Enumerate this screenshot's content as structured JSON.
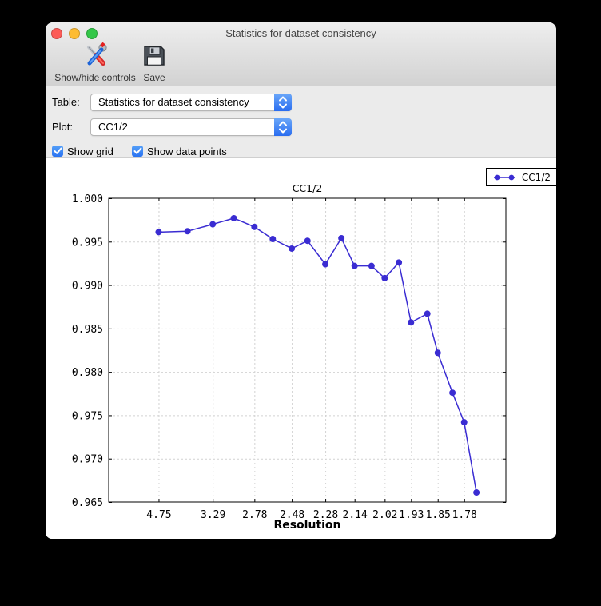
{
  "window": {
    "title": "Statistics for dataset consistency",
    "traffic_lights": {
      "close": "#fc5b57",
      "minimize": "#fdbc32",
      "maximize": "#33c748"
    }
  },
  "toolbar": {
    "items": [
      {
        "label": "Show/hide controls",
        "icon": "tools-icon"
      },
      {
        "label": "Save",
        "icon": "save-icon"
      }
    ]
  },
  "controls": {
    "table": {
      "label": "Table:",
      "value": "Statistics for dataset consistency"
    },
    "plot": {
      "label": "Plot:",
      "value": "CC1/2"
    },
    "checkboxes": [
      {
        "label": "Show grid",
        "checked": true
      },
      {
        "label": "Show data points",
        "checked": true
      }
    ],
    "accent_color": "#2f7bf3"
  },
  "legend": {
    "label": "CC1/2",
    "position": "top-right"
  },
  "chart_data": {
    "type": "line",
    "title": "CC1/2",
    "xlabel": "Resolution",
    "x_scale": "inverse_d_squared",
    "xlim_inv_d2": [
      0,
      0.3527
    ],
    "ylim": [
      0.965,
      1.0
    ],
    "grid": true,
    "grid_style": "dashed",
    "x_tick_labels": [
      "4.75",
      "3.29",
      "2.78",
      "2.48",
      "2.28",
      "2.14",
      "2.02",
      "1.93",
      "1.85",
      "1.78"
    ],
    "y_tick_labels": [
      "1.000",
      "0.995",
      "0.990",
      "0.985",
      "0.980",
      "0.975",
      "0.970",
      "0.965"
    ],
    "series": [
      {
        "name": "CC1/2",
        "color": "#3a2cd2",
        "marker": "circle",
        "x_resolution": [
          4.75,
          3.78,
          3.29,
          3.0,
          2.78,
          2.62,
          2.48,
          2.38,
          2.28,
          2.2,
          2.14,
          2.07,
          2.02,
          1.97,
          1.93,
          1.88,
          1.85,
          1.81,
          1.78,
          1.75
        ],
        "values": [
          0.9961,
          0.9962,
          0.997,
          0.9977,
          0.9967,
          0.9953,
          0.9942,
          0.9951,
          0.9924,
          0.9954,
          0.9922,
          0.9922,
          0.9908,
          0.9926,
          0.9857,
          0.9867,
          0.9822,
          0.9776,
          0.9742,
          0.9661
        ]
      }
    ]
  }
}
